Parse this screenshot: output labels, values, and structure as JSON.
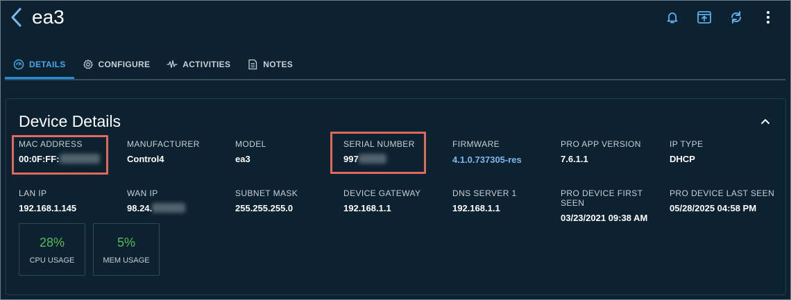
{
  "header": {
    "title": "ea3",
    "icons": [
      "chevron-left-icon",
      "bell-icon",
      "upload-icon",
      "refresh-icon",
      "more-vertical-icon"
    ]
  },
  "tabs": [
    {
      "label": "DETAILS",
      "icon": "gauge-icon",
      "active": true
    },
    {
      "label": "CONFIGURE",
      "icon": "gear-icon",
      "active": false
    },
    {
      "label": "ACTIVITIES",
      "icon": "pulse-icon",
      "active": false
    },
    {
      "label": "NOTES",
      "icon": "notes-icon",
      "active": false
    }
  ],
  "card": {
    "title": "Device Details",
    "fields": {
      "mac_address": {
        "label": "MAC ADDRESS",
        "value": "00:0F:FF:"
      },
      "manufacturer": {
        "label": "MANUFACTURER",
        "value": "Control4"
      },
      "model": {
        "label": "MODEL",
        "value": "ea3"
      },
      "serial_number": {
        "label": "SERIAL NUMBER",
        "value": "997"
      },
      "firmware": {
        "label": "FIRMWARE",
        "value": "4.1.0.737305-res"
      },
      "pro_app_version": {
        "label": "PRO APP VERSION",
        "value": "7.6.1.1"
      },
      "ip_type": {
        "label": "IP TYPE",
        "value": "DHCP"
      },
      "lan_ip": {
        "label": "LAN IP",
        "value": "192.168.1.145"
      },
      "wan_ip": {
        "label": "WAN IP",
        "value": "98.24."
      },
      "subnet_mask": {
        "label": "SUBNET MASK",
        "value": "255.255.255.0"
      },
      "device_gateway": {
        "label": "DEVICE GATEWAY",
        "value": "192.168.1.1"
      },
      "dns_server_1": {
        "label": "DNS SERVER 1",
        "value": "192.168.1.1"
      },
      "first_seen": {
        "label": "PRO DEVICE FIRST SEEN",
        "value": "03/23/2021 09:38 AM"
      },
      "last_seen": {
        "label": "PRO DEVICE LAST SEEN",
        "value": "05/28/2025 04:58 PM"
      }
    },
    "gauges": {
      "cpu": {
        "label": "CPU USAGE",
        "value": "28%"
      },
      "mem": {
        "label": "MEM USAGE",
        "value": "5%"
      }
    }
  },
  "colors": {
    "background": "#0d2230",
    "accent": "#1f8fdc",
    "link": "#7fb8ea",
    "good": "#5cb85c",
    "highlight": "#e2685c"
  }
}
